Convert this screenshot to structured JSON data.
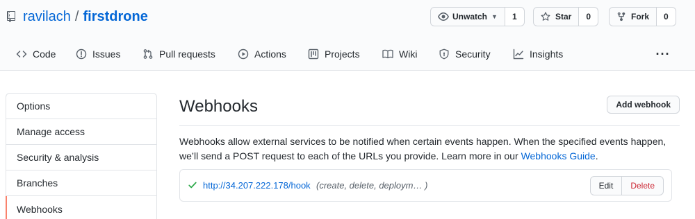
{
  "repo": {
    "owner": "ravilach",
    "separator": "/",
    "name": "firstdrone"
  },
  "actions": {
    "watch": {
      "label": "Unwatch",
      "count": "1",
      "icon": "eye-icon"
    },
    "star": {
      "label": "Star",
      "count": "0",
      "icon": "star-icon"
    },
    "fork": {
      "label": "Fork",
      "count": "0",
      "icon": "fork-icon"
    }
  },
  "tabs": [
    {
      "label": "Code",
      "icon": "code-icon"
    },
    {
      "label": "Issues",
      "icon": "issue-icon"
    },
    {
      "label": "Pull requests",
      "icon": "pull-request-icon"
    },
    {
      "label": "Actions",
      "icon": "play-icon"
    },
    {
      "label": "Projects",
      "icon": "project-icon"
    },
    {
      "label": "Wiki",
      "icon": "book-icon"
    },
    {
      "label": "Security",
      "icon": "shield-icon"
    },
    {
      "label": "Insights",
      "icon": "graph-icon"
    }
  ],
  "more_label": "···",
  "sidebar": {
    "items": [
      {
        "label": "Options"
      },
      {
        "label": "Manage access"
      },
      {
        "label": "Security & analysis"
      },
      {
        "label": "Branches"
      },
      {
        "label": "Webhooks",
        "active": true
      }
    ]
  },
  "main": {
    "title": "Webhooks",
    "add_button": "Add webhook",
    "description_1": "Webhooks allow external services to be notified when certain events happen. When the specified events happen,",
    "description_2": "we’ll send a POST request to each of the URLs you provide. Learn more in our ",
    "guide_link": "Webhooks Guide",
    "description_end": "."
  },
  "hook": {
    "url": "http://34.207.222.178/hook",
    "events": "(create, delete, deploym…  )",
    "edit_label": "Edit",
    "delete_label": "Delete",
    "status_icon": "check-icon"
  },
  "colors": {
    "link": "#0366d6",
    "active_accent": "#f9826c",
    "success": "#28a745",
    "danger": "#cb2431"
  }
}
